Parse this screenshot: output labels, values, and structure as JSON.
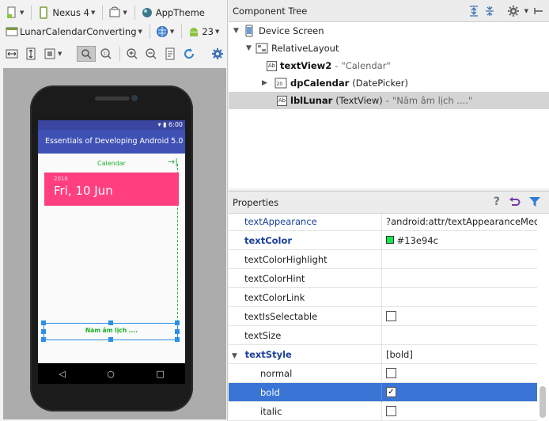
{
  "toolbar": {
    "device": "Nexus 4",
    "theme": "AppTheme",
    "activity": "LunarCalendarConverting",
    "api_level": "23"
  },
  "phone": {
    "status_time": "6:00",
    "app_title": "Essentials of Developing Android 5.0",
    "calendar_label": "Calendar",
    "date_year": "2016",
    "date_text": "Fri, 10 Jun",
    "lunar_text": "Năm âm lịch ....",
    "nav_back": "◁",
    "nav_home": "○",
    "nav_recent": "□"
  },
  "component_tree": {
    "title": "Component Tree",
    "nodes": [
      {
        "name": "Device Screen",
        "detail": "",
        "str": ""
      },
      {
        "name": "RelativeLayout",
        "detail": "",
        "str": ""
      },
      {
        "name": "textView2",
        "detail": "",
        "str": "\"Calendar\""
      },
      {
        "name": "dpCalendar",
        "detail": "(DatePicker)",
        "str": ""
      },
      {
        "name": "lblLunar",
        "detail": "(TextView)",
        "str": "\"Năm âm lịch ....\""
      }
    ]
  },
  "properties": {
    "title": "Properties",
    "rows": [
      {
        "name": "textAppearance",
        "value": "?android:attr/textAppearanceMediur"
      },
      {
        "name": "textColor",
        "value": "#13e94c"
      },
      {
        "name": "textColorHighlight",
        "value": ""
      },
      {
        "name": "textColorHint",
        "value": ""
      },
      {
        "name": "textColorLink",
        "value": ""
      },
      {
        "name": "textIsSelectable",
        "value": ""
      },
      {
        "name": "textSize",
        "value": ""
      },
      {
        "name": "textStyle",
        "value": "[bold]"
      },
      {
        "name": "normal",
        "value": ""
      },
      {
        "name": "bold",
        "value": "✓"
      },
      {
        "name": "italic",
        "value": ""
      }
    ]
  },
  "colors": {
    "accent_blue": "#3a75d6",
    "text_color_swatch": "#13e94c",
    "app_bar": "#3f51b5",
    "date_box": "#ff3f7f"
  }
}
